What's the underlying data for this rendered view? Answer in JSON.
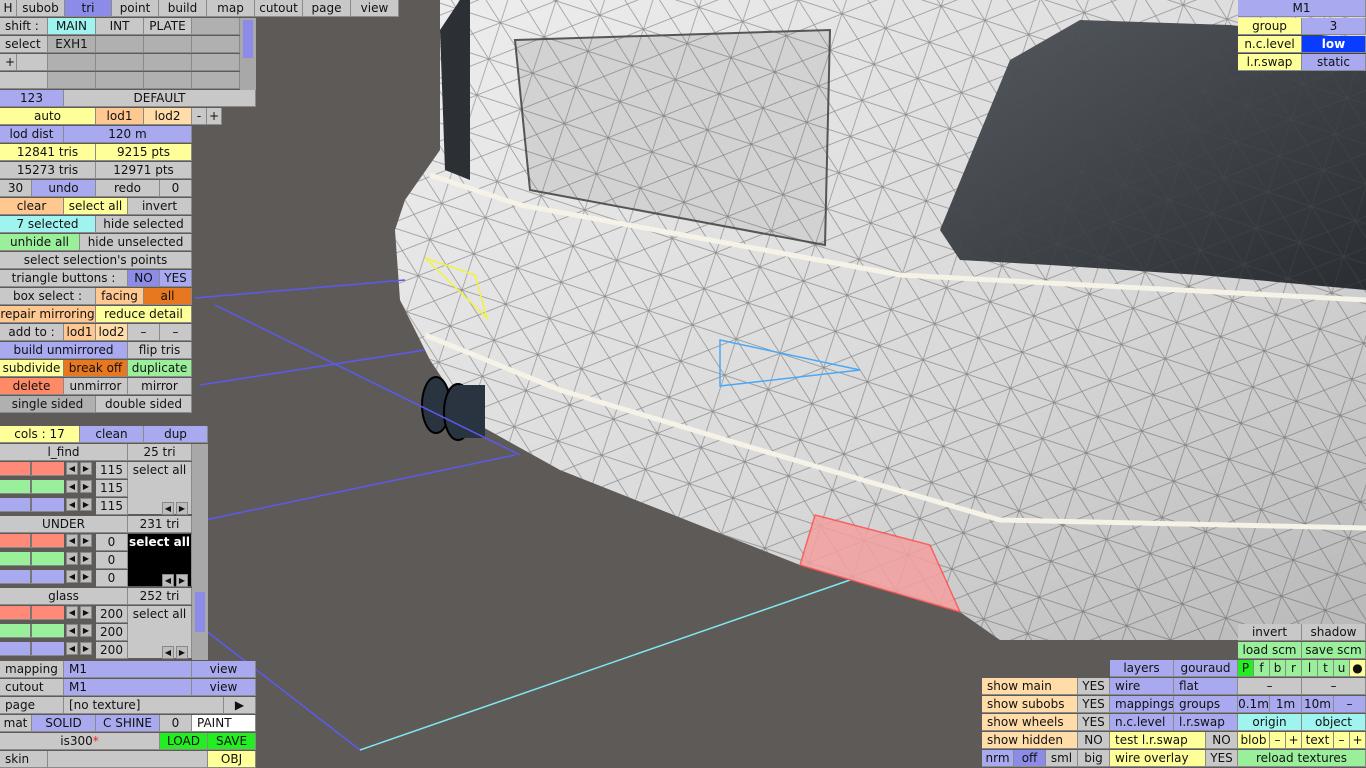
{
  "top_tabs": [
    "H",
    "subob",
    "tri",
    "point",
    "build",
    "map",
    "cutout",
    "page",
    "view"
  ],
  "shift": {
    "label": "shift :",
    "items": [
      "MAIN",
      "INT",
      "PLATE"
    ]
  },
  "select": {
    "label": "select",
    "item": "EXH1"
  },
  "plus": "+",
  "mat_id": "123",
  "default_label": "DEFAULT",
  "lod": {
    "auto": "auto",
    "lod1": "lod1",
    "lod2": "lod2",
    "minus": "-",
    "plus": "+"
  },
  "lod_dist": {
    "label": "lod dist",
    "value": "120 m"
  },
  "counts": {
    "tris1": "12841 tris",
    "pts1": "9215 pts",
    "tris2": "15273 tris",
    "pts2": "12971 pts"
  },
  "undo_row": {
    "left": "30",
    "undo": "undo",
    "redo": "redo",
    "right": "0"
  },
  "buttons": {
    "clear": "clear",
    "select_all": "select all",
    "invert": "invert",
    "selected_count": "7 selected",
    "hide_selected": "hide selected",
    "unhide_all": "unhide all",
    "hide_unselected": "hide unselected",
    "select_points": "select selection's points",
    "triangle_buttons": "triangle buttons :",
    "no": "NO",
    "yes": "YES",
    "box_select": "box select :",
    "facing": "facing",
    "all": "all",
    "repair_mirroring": "repair mirroring",
    "reduce_detail": "reduce detail",
    "add_to": "add to :",
    "lod1": "lod1",
    "lod2": "lod2",
    "dash": "–",
    "build_unmirrored": "build unmirrored",
    "flip_tris": "flip tris",
    "subdivide": "subdivide",
    "break_off": "break off",
    "duplicate": "duplicate",
    "delete": "delete",
    "unmirror": "unmirror",
    "mirror": "mirror",
    "single_sided": "single sided",
    "double_sided": "double sided"
  },
  "cols": {
    "label": "cols : 17",
    "clean": "clean",
    "dup": "dup"
  },
  "materials": [
    {
      "name": "l_find",
      "tris": "25 tri",
      "values": [
        "115",
        "115",
        "115"
      ],
      "btn": "select all",
      "colors": [
        "#ff8a78",
        "#9af09a",
        "#a9a9ef"
      ]
    },
    {
      "name": "UNDER",
      "tris": "231 tri",
      "values": [
        "0",
        "0",
        "0"
      ],
      "btn": "select all",
      "colors": [
        "#ff8a78",
        "#9af09a",
        "#a9a9ef"
      ]
    },
    {
      "name": "glass",
      "tris": "252 tri",
      "values": [
        "200",
        "200",
        "200"
      ],
      "btn": "select all",
      "colors": [
        "#ff8a78",
        "#9af09a",
        "#a9a9ef"
      ]
    }
  ],
  "mapping": {
    "label": "mapping",
    "value": "M1",
    "view": "view"
  },
  "cutout": {
    "label": "cutout",
    "value": "M1",
    "view": "view"
  },
  "page": {
    "label": "page",
    "value": "[no texture]",
    "arrow": "▶"
  },
  "mat_row": {
    "mat": "mat",
    "solid": "SOLID",
    "shine": "C SHINE",
    "zero": "0",
    "paint": "PAINT"
  },
  "file": {
    "name": "is300",
    "mark": "*",
    "load": "LOAD",
    "save": "SAVE"
  },
  "skin": {
    "label": "skin",
    "obj": "OBJ"
  },
  "top_right": {
    "title": "M1",
    "group_label": "group",
    "group_value": "3",
    "nclevel_label": "n.c.level",
    "nclevel_value": "low",
    "lrswap_label": "l.r.swap",
    "lrswap_value": "static"
  },
  "bottom_right": {
    "invert": "invert",
    "shadow": "shadow",
    "load_scm": "load scm",
    "save_scm": "save scm",
    "letters": [
      "P",
      "f",
      "b",
      "r",
      "l",
      "t",
      "u",
      "●"
    ],
    "dash": "–",
    "m01": "0.1m",
    "m1": "1m",
    "m10": "10m",
    "origin": "origin",
    "object": "object",
    "blob": "blob",
    "text": "text",
    "minus": "–",
    "plus": "+",
    "reload": "reload textures",
    "layers": "layers",
    "gouraud": "gouraud",
    "wire": "wire",
    "flat": "flat",
    "mappings": "mappings",
    "groups": "groups",
    "nclevel": "n.c.level",
    "lrswap": "l.r.swap",
    "test_lrswap": "test l.r.swap",
    "no": "NO",
    "wire_overlay": "wire overlay",
    "yes": "YES",
    "show_main": "show main",
    "show_subobs": "show subobs",
    "show_wheels": "show wheels",
    "show_hidden": "show hidden",
    "yes1": "YES",
    "yes2": "YES",
    "yes3": "YES",
    "no1": "NO",
    "nrm": "nrm",
    "off": "off",
    "sml": "sml",
    "big": "big"
  },
  "colors": {
    "panel": "#c8c8c8",
    "blue": "#a9a9ef",
    "yellow": "#ffff99",
    "orange": "#ffc890",
    "green": "#9af09a",
    "red": "#ff8a68",
    "ground": "#5e5a57"
  }
}
